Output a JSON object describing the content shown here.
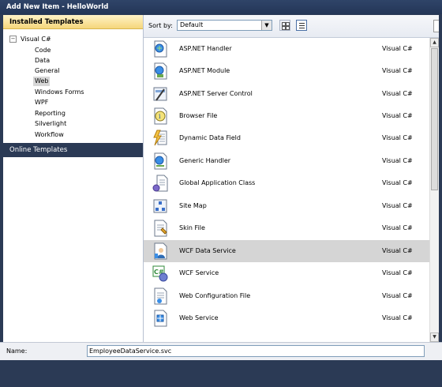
{
  "window": {
    "title": "Add New Item - HelloWorld"
  },
  "left": {
    "installed_header": "Installed Templates",
    "root": {
      "toggle": "−",
      "label": "Visual C#"
    },
    "children": [
      "Code",
      "Data",
      "General",
      "Web",
      "Windows Forms",
      "WPF",
      "Reporting",
      "Silverlight",
      "Workflow"
    ],
    "selected_child": "Web",
    "online_header": "Online Templates"
  },
  "toolbar": {
    "sort_label": "Sort by:",
    "sort_value": "Default",
    "sort_arrow": "▼"
  },
  "templates": [
    {
      "name": "ASP.NET Handler",
      "lang": "Visual C#",
      "icon": "aspnet-handler-icon"
    },
    {
      "name": "ASP.NET Module",
      "lang": "Visual C#",
      "icon": "aspnet-module-icon"
    },
    {
      "name": "ASP.NET Server Control",
      "lang": "Visual C#",
      "icon": "server-control-icon"
    },
    {
      "name": "Browser File",
      "lang": "Visual C#",
      "icon": "browser-file-icon"
    },
    {
      "name": "Dynamic Data Field",
      "lang": "Visual C#",
      "icon": "dynamic-data-icon"
    },
    {
      "name": "Generic Handler",
      "lang": "Visual C#",
      "icon": "generic-handler-icon"
    },
    {
      "name": "Global Application Class",
      "lang": "Visual C#",
      "icon": "global-app-class-icon"
    },
    {
      "name": "Site Map",
      "lang": "Visual C#",
      "icon": "site-map-icon"
    },
    {
      "name": "Skin File",
      "lang": "Visual C#",
      "icon": "skin-file-icon"
    },
    {
      "name": "WCF Data Service",
      "lang": "Visual C#",
      "icon": "wcf-data-service-icon"
    },
    {
      "name": "WCF Service",
      "lang": "Visual C#",
      "icon": "wcf-service-icon"
    },
    {
      "name": "Web Configuration File",
      "lang": "Visual C#",
      "icon": "web-config-icon"
    },
    {
      "name": "Web Service",
      "lang": "Visual C#",
      "icon": "web-service-icon"
    }
  ],
  "selected_template": "WCF Data Service",
  "scrollbar": {
    "up": "▲",
    "down": "▼"
  },
  "bottom": {
    "name_label": "Name:",
    "name_value": "EmployeeDataService.svc"
  }
}
